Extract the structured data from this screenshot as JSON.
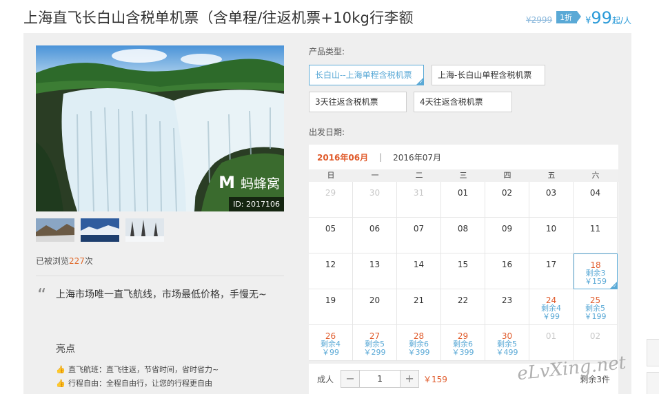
{
  "product": {
    "title": "上海直飞长白山含税单机票（含单程/往返机票+10kg行李额",
    "old_price": "¥2999",
    "discount": "1折",
    "price_symbol": "¥",
    "price": "99",
    "price_unit": "起/人"
  },
  "gallery": {
    "watermark": "蚂蜂窝",
    "image_id": "ID: 2017106",
    "thumbs": [
      "thumb-1",
      "thumb-2",
      "thumb-3"
    ]
  },
  "views": {
    "prefix": "已被浏览",
    "count": "227",
    "suffix": "次"
  },
  "quote": "上海市场唯一直飞航线，市场最低价格，手慢无~",
  "highlights": {
    "title": "亮点",
    "items": [
      "直飞航班：直飞往返，节省时间，省时省力~",
      "行程自由：全程自由行，让您的行程更自由"
    ]
  },
  "product_type": {
    "label": "产品类型:",
    "options": [
      "长白山--上海单程含税机票",
      "上海-长白山单程含税机票",
      "3天往返含税机票",
      "4天往返含税机票"
    ],
    "selected": 0
  },
  "departure": {
    "label": "出发日期:",
    "months": [
      "2016年06月",
      "2016年07月"
    ],
    "divider": "|",
    "weekdays": [
      "日",
      "一",
      "二",
      "三",
      "四",
      "五",
      "六"
    ],
    "days": [
      {
        "d": "29",
        "other": true
      },
      {
        "d": "30",
        "other": true
      },
      {
        "d": "31",
        "other": true
      },
      {
        "d": "01"
      },
      {
        "d": "02"
      },
      {
        "d": "03"
      },
      {
        "d": "04"
      },
      {
        "d": "05"
      },
      {
        "d": "06"
      },
      {
        "d": "07"
      },
      {
        "d": "08"
      },
      {
        "d": "09"
      },
      {
        "d": "10"
      },
      {
        "d": "11"
      },
      {
        "d": "12"
      },
      {
        "d": "13"
      },
      {
        "d": "14"
      },
      {
        "d": "15"
      },
      {
        "d": "16"
      },
      {
        "d": "17"
      },
      {
        "d": "18",
        "rem": "剩余3",
        "price": "￥159",
        "selected": true
      },
      {
        "d": "19"
      },
      {
        "d": "20"
      },
      {
        "d": "21"
      },
      {
        "d": "22"
      },
      {
        "d": "23"
      },
      {
        "d": "24",
        "rem": "剩余4",
        "price": "￥99"
      },
      {
        "d": "25",
        "rem": "剩余5",
        "price": "￥199"
      },
      {
        "d": "26",
        "rem": "剩余4",
        "price": "￥99"
      },
      {
        "d": "27",
        "rem": "剩余5",
        "price": "￥299"
      },
      {
        "d": "28",
        "rem": "剩余6",
        "price": "￥399"
      },
      {
        "d": "29",
        "rem": "剩余6",
        "price": "￥399"
      },
      {
        "d": "30",
        "rem": "剩余5",
        "price": "￥499"
      },
      {
        "d": "01",
        "other": true
      },
      {
        "d": "02",
        "other": true
      }
    ]
  },
  "quantity": {
    "label": "成人",
    "minus": "−",
    "value": "1",
    "plus": "+",
    "price": "￥159",
    "remain": "剩余3件"
  },
  "site_watermark": "eLvXing.net"
}
